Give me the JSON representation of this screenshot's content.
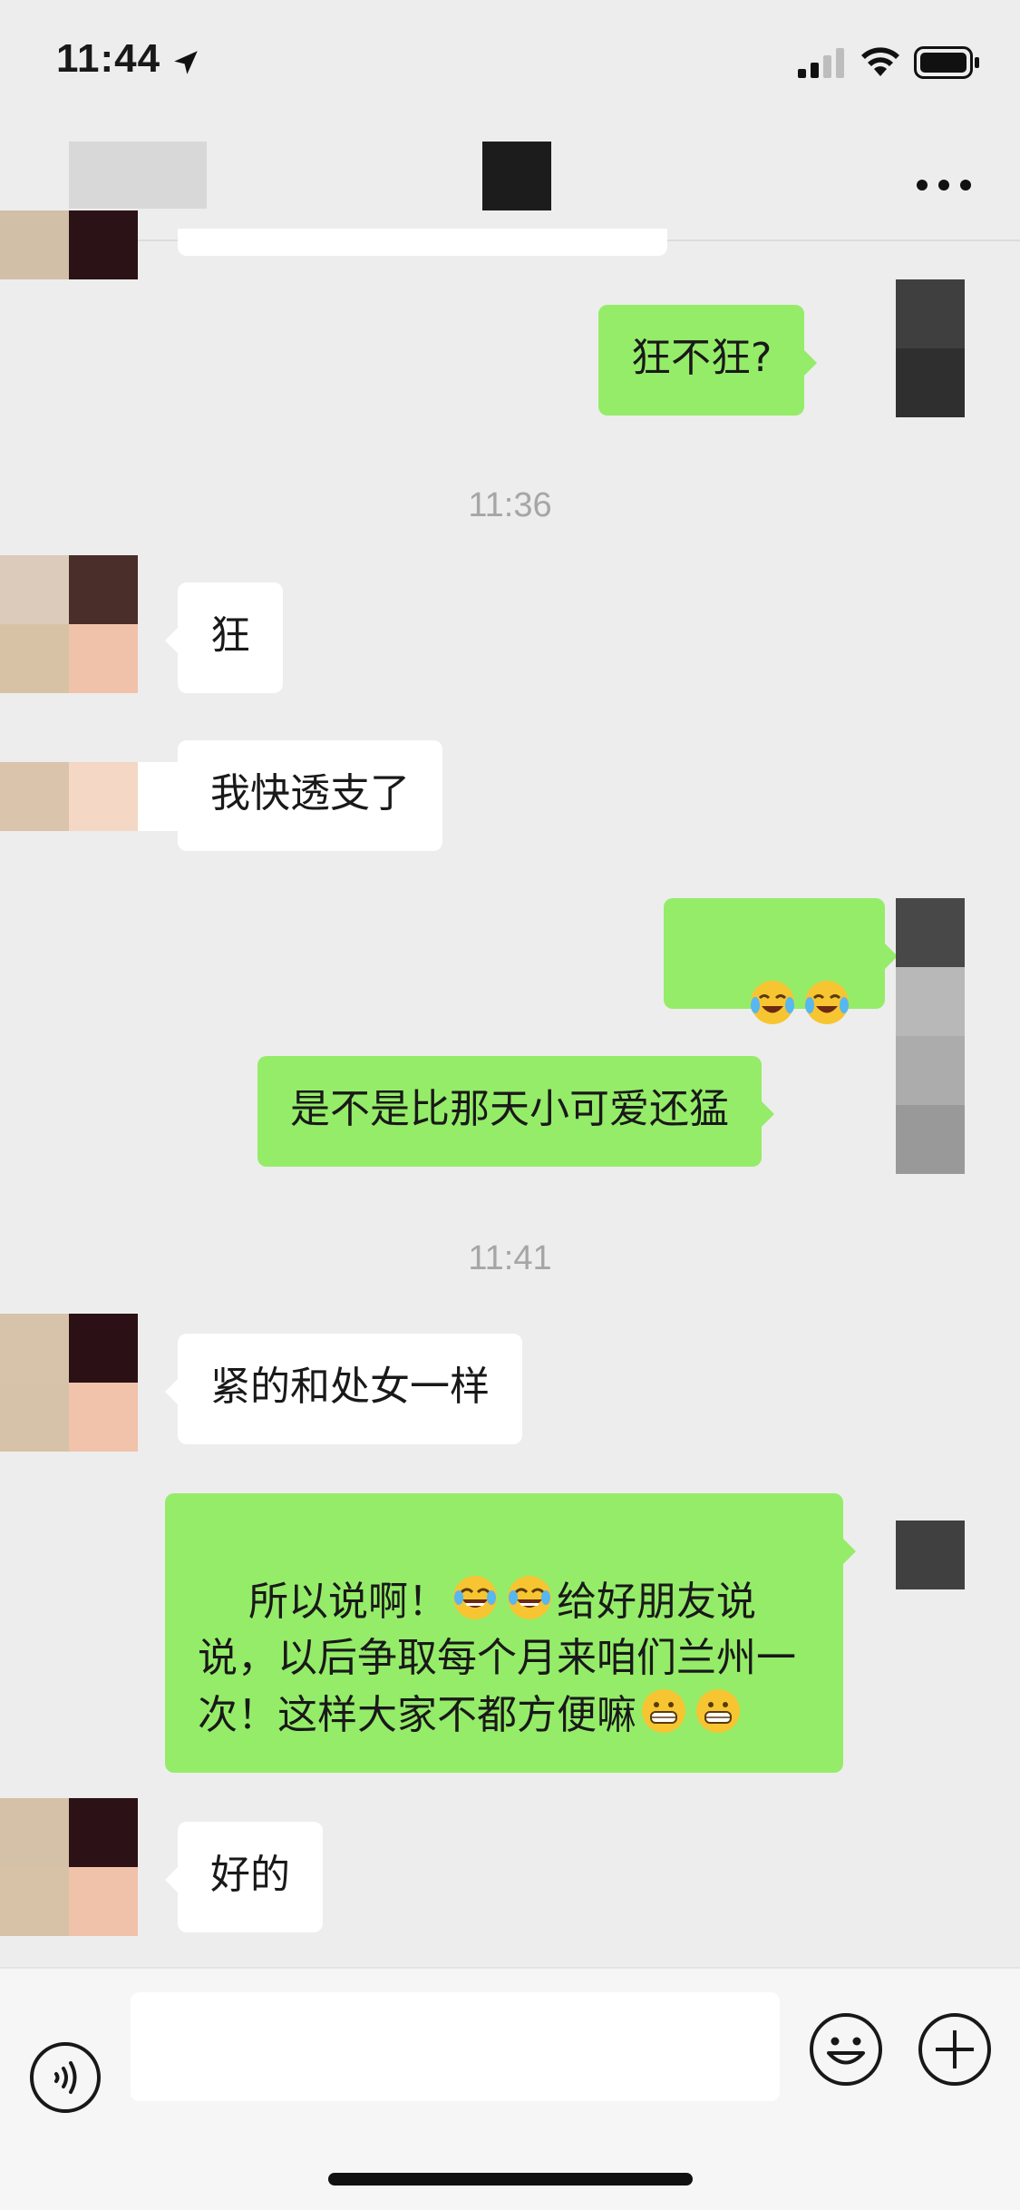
{
  "status_bar": {
    "time": "11:44"
  },
  "nav": {
    "title": ""
  },
  "timestamps": [
    "11:36",
    "11:41"
  ],
  "messages": [
    {
      "from": "me",
      "text": "狂不狂?"
    },
    {
      "from": "them",
      "text": "狂"
    },
    {
      "from": "them",
      "text": "我快透支了"
    },
    {
      "from": "me",
      "emojis": [
        "crying-laughing-emoji",
        "crying-laughing-emoji"
      ]
    },
    {
      "from": "me",
      "text": "是不是比那天小可爱还猛"
    },
    {
      "from": "them",
      "text": "紧的和处女一样"
    },
    {
      "from": "me",
      "text_parts": [
        "所以说啊！",
        "给好朋友说说，以后争取每个月来咱们兰州一次！这样大家不都方便嘛"
      ],
      "emojis": [
        "tears-of-joy-emoji",
        "tears-of-joy-emoji",
        "grimacing-grin-emoji",
        "grimacing-grin-emoji"
      ]
    },
    {
      "from": "them",
      "text": "好的"
    }
  ],
  "input_bar": {
    "placeholder": ""
  },
  "colors": {
    "background": "#ededed",
    "outgoing_bubble": "#95ec69",
    "incoming_bubble": "#ffffff",
    "timestamp": "#a6a6a6"
  }
}
